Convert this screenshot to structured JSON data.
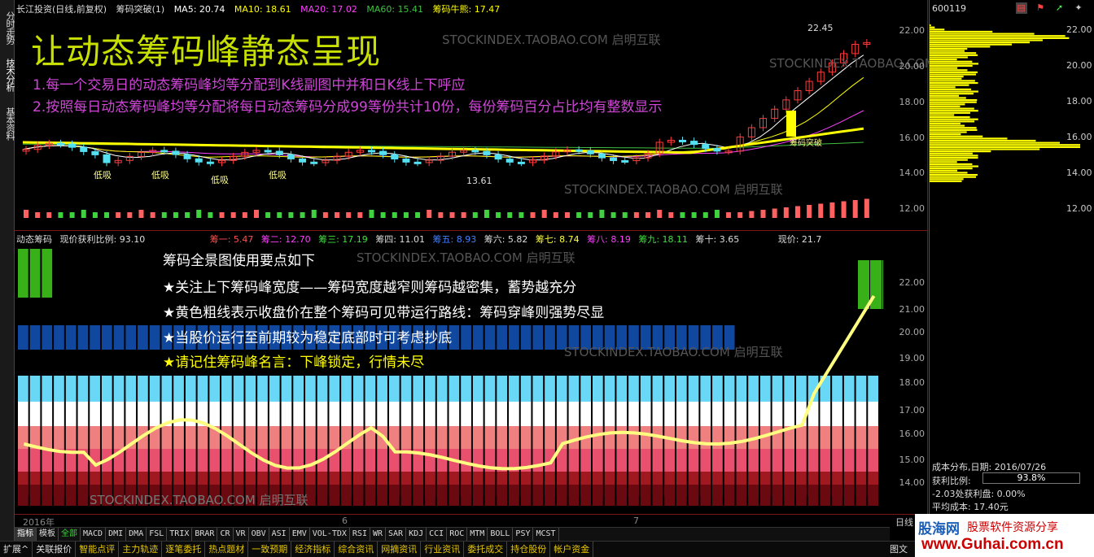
{
  "left_tabs": [
    "分时走势",
    "技术分析",
    "基本资料"
  ],
  "upper": {
    "header": {
      "stock": "长江投资(日线,前复权)",
      "indicator": "筹码突破(1)",
      "ma5": "MA5: 20.74",
      "ma10": "MA10: 18.61",
      "ma20": "MA20: 17.02",
      "ma60": "MA60: 15.41",
      "chip": "筹码牛熊: 17.47"
    },
    "title": "让动态筹码峰静态呈现",
    "desc1": "1.每一个交易日的动态筹码峰均等分配到K线副图中并和日K线上下呼应",
    "desc2": "2.按照每日动态筹码峰均等分配将每日动态筹码分成99等份共计10份，每份筹码百分占比均有整数显示",
    "watermark": "STOCKINDEX.TAOBAO.COM 启明互联",
    "high_label": "22.45",
    "low_label": "13.61",
    "breakout_label": "筹码突破",
    "dip_label": "低吸",
    "y_ticks": [
      "22.00",
      "20.00",
      "18.00",
      "16.00",
      "14.00",
      "12.00"
    ]
  },
  "lower": {
    "header": {
      "name": "动态筹码",
      "profit": "现价获利比例: 93.10",
      "p1": "筹一: 5.47",
      "p2": "筹二: 12.70",
      "p3": "筹三: 17.19",
      "p4": "筹四: 11.01",
      "p5": "筹五: 8.93",
      "p6": "筹六: 5.82",
      "p7": "筹七: 8.74",
      "p8": "筹八: 8.19",
      "p9": "筹九: 18.11",
      "p10": "筹十: 3.65",
      "price": "现价: 21.7"
    },
    "tips": [
      "筹码全景图使用要点如下",
      "★关注上下筹码峰宽度——筹码宽度越窄则筹码越密集，蓄势越充分",
      "★黄色粗线表示收盘价在整个筹码可见带运行路线：筹码穿峰则强势尽显",
      "★当股价运行至前期较为稳定底部时可考虑抄底",
      "★请记住筹码峰名言：下峰锁定，行情未尽"
    ],
    "watermark": "STOCKINDEX.TAOBAO.COM 启明互联",
    "y_ticks": [
      "22.00",
      "21.00",
      "20.00",
      "19.00",
      "18.00",
      "17.00",
      "16.00",
      "15.00",
      "14.00"
    ]
  },
  "date_axis": [
    "2016年",
    "6",
    "7"
  ],
  "axis_corner": "日线",
  "indicator_tabs": [
    "指标",
    "模板",
    "全部",
    "MACD",
    "DMI",
    "DMA",
    "FSL",
    "TRIX",
    "BRAR",
    "CR",
    "VR",
    "OBV",
    "ASI",
    "EMV",
    "VOL-TDX",
    "RSI",
    "WR",
    "SAR",
    "KDJ",
    "CCI",
    "ROC",
    "MTM",
    "BOLL",
    "PSY",
    "MCST"
  ],
  "bottom_tabs": [
    "扩展^",
    "关联报价",
    "智能点评",
    "主力轨迹",
    "逐笔委托",
    "热点题材",
    "一致预期",
    "经济指标",
    "综合资讯",
    "网摘资讯",
    "行业资讯",
    "委托成交",
    "持仓股份",
    "帐户资金"
  ],
  "bottom_right": "图文",
  "side": {
    "code": "600119",
    "dist_title": "成本分布,日期:",
    "dist_date": "2016/07/26",
    "profit_label": "获利比例:",
    "profit_value": "93.8%",
    "profit_line": "-2.03处获利盘: 0.00%",
    "avg_cost": "平均成本: 17.40元",
    "y_ticks": [
      "22.00",
      "20.00",
      "18.00",
      "16.00",
      "14.00",
      "12.00"
    ],
    "logo_name": "股海网",
    "logo_slogan": "股票软件资源分享",
    "logo_url": "www.Guhai.com.cn"
  },
  "colors": {
    "up": "#ff3b3b",
    "down": "#54e0f0",
    "title": "#c8e000",
    "desc": "#d045d8",
    "ma5": "#ffffff",
    "ma10": "#ffff00",
    "ma20": "#ff40ff",
    "ma60": "#40c040",
    "chip": "#ffff00",
    "profile": "#ffff00"
  }
}
